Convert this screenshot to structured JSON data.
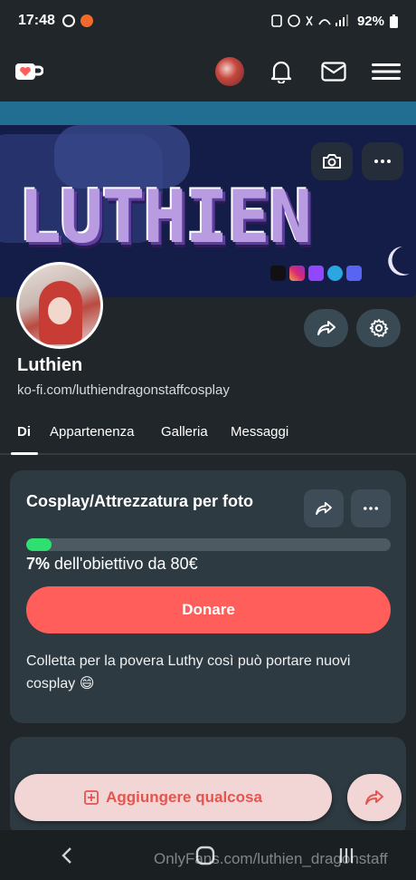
{
  "status_bar": {
    "time": "17:48",
    "battery": "92%"
  },
  "topnav": {
    "logo_icon": "kofi-cup-heart-icon",
    "icons": [
      "avatar",
      "bell-icon",
      "mail-icon",
      "hamburger-menu-icon"
    ]
  },
  "banner": {
    "title": "LUTHIEN",
    "socials": [
      "tiktok-icon",
      "instagram-icon",
      "twitch-icon",
      "telegram-icon",
      "discord-icon"
    ]
  },
  "profile": {
    "name": "Luthien",
    "url": "ko-fi.com/luthiendragonstaffcosplay"
  },
  "tabs": [
    "Di",
    "Appartenenza",
    "Galleria",
    "Messaggi"
  ],
  "active_tab": "Di",
  "goal_card": {
    "title": "Cosplay/Attrezzatura per foto",
    "progress_fraction": 0.07,
    "percent": "7%",
    "goal_text": "dell'obiettivo da 80€",
    "donate_label": "Donare",
    "description": "Colletta per la povera Luthy così può portare nuovi cosplay 😄"
  },
  "bottom": {
    "add_label": "Aggiungere qualcosa"
  },
  "watermark": "OnlyFans.com/luthien_dragonstaff",
  "colors": {
    "background": "#202629",
    "card": "#2d3a41",
    "accent": "#ff5e5b",
    "progress": "#2ee06f",
    "banner": "#141d48"
  }
}
